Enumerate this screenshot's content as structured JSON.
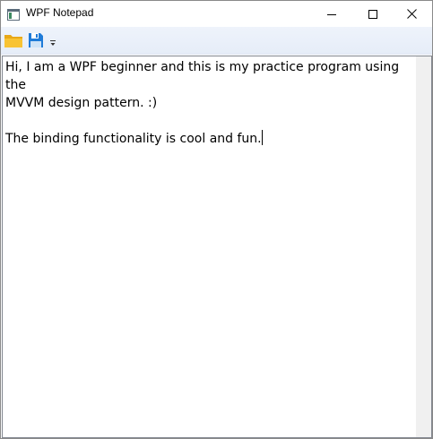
{
  "window": {
    "title": "WPF Notepad"
  },
  "toolbar": {
    "items": [
      {
        "name": "open",
        "icon": "folder-icon"
      },
      {
        "name": "save",
        "icon": "save-icon"
      },
      {
        "name": "overflow",
        "icon": "toolbar-overflow-icon"
      }
    ]
  },
  "editor": {
    "line1": "Hi, I am a WPF beginner and this is my practice program using the",
    "line2": "MVVM design pattern. :)",
    "line3": "",
    "line4": "The binding functionality is cool and fun."
  },
  "colors": {
    "toolbar_bg": "#eef3fb",
    "folder_yellow": "#f8c333",
    "save_blue": "#1f7bd8"
  }
}
